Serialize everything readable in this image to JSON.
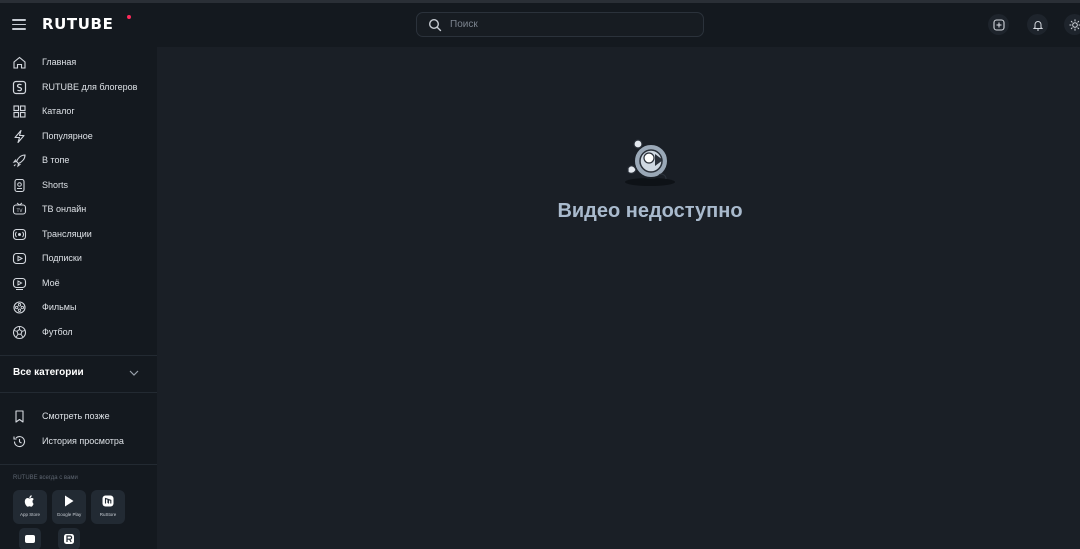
{
  "header": {
    "logo": "RUTUBE",
    "search_placeholder": "Поиск"
  },
  "sidebar": {
    "items": [
      {
        "label": "Главная",
        "icon": "home-icon"
      },
      {
        "label": "RUTUBE для блогеров",
        "icon": "studio-icon"
      },
      {
        "label": "Каталог",
        "icon": "catalog-icon"
      },
      {
        "label": "Популярное",
        "icon": "lightning-icon"
      },
      {
        "label": "В топе",
        "icon": "rocket-icon"
      },
      {
        "label": "Shorts",
        "icon": "shorts-icon"
      },
      {
        "label": "ТВ онлайн",
        "icon": "tv-icon"
      },
      {
        "label": "Трансляции",
        "icon": "broadcast-icon"
      },
      {
        "label": "Подписки",
        "icon": "subscriptions-icon"
      },
      {
        "label": "Моё",
        "icon": "my-icon"
      },
      {
        "label": "Фильмы",
        "icon": "film-icon"
      },
      {
        "label": "Футбол",
        "icon": "football-icon"
      }
    ],
    "categories_title": "Все категории",
    "secondary": [
      {
        "label": "Смотреть позже",
        "icon": "bookmark-icon"
      },
      {
        "label": "История просмотра",
        "icon": "history-icon"
      }
    ],
    "always_label": "RUTUBE всегда с вами",
    "stores": [
      {
        "label": "App Store",
        "icon": "apple-icon"
      },
      {
        "label": "Google Play",
        "icon": "google-play-icon"
      },
      {
        "label": "RuStore",
        "icon": "rustore-icon"
      }
    ]
  },
  "main": {
    "message": "Видео недоступно"
  },
  "colors": {
    "background": "#14191f",
    "main_background": "#1a1f26",
    "accent": "#ff2a5b",
    "message": "#a9bacd"
  }
}
